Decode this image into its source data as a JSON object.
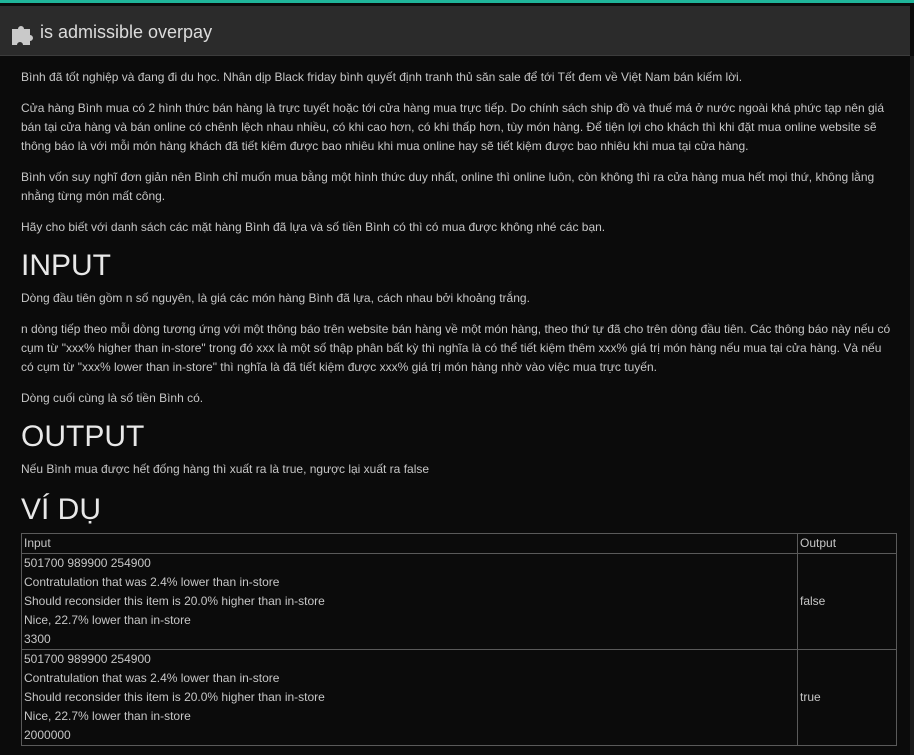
{
  "window": {
    "title": "is admissible overpay",
    "icon": "puzzle-piece-icon"
  },
  "problem": {
    "paragraphs": [
      "Bình đã tốt nghiệp và đang đi du học. Nhân dịp Black friday bình quyết định tranh thủ săn sale để tới Tết đem về Việt Nam bán kiếm lời.",
      "Cửa hàng Bình mua có 2 hình thức bán hàng là trực tuyết hoặc tới cửa hàng mua trực tiếp. Do chính sách ship đồ và thuế má ở nước ngoài khá phức tạp nên giá bán tại cửa hàng và bán online có chênh lệch nhau nhiều, có khi cao hơn, có khi thấp hơn, tùy món hàng.  Để tiện lợi cho khách thì khi đặt mua online website sẽ thông báo là với mỗi món hàng khách đã tiết kiêm được bao nhiêu khi mua online hay sẽ tiết kiệm được bao nhiêu khi mua tại cửa hàng.",
      "Bình vốn suy nghĩ đơn giản nên Bình chỉ muốn mua bằng một hình thức duy nhất, online thì online luôn, còn không thì ra cửa hàng mua hết mọi thứ, không lằng nhằng từng món mất công.",
      "Hãy cho biết với danh sách các mặt hàng Bình đã lựa và số tiền Bình có thì có mua được không nhé các bạn."
    ],
    "input_heading": "INPUT",
    "input_paragraphs": [
      "Dòng đầu tiên gồm n số nguyên, là giá các món hàng Bình đã lựa, cách nhau bởi khoảng trắng.",
      "n  dòng tiếp theo mỗi dòng tương ứng với một thông báo trên website bán hàng về một món hàng, theo thứ tự đã cho trên dòng đầu tiên. Các thông báo này nếu có cụm từ \"xxx% higher than in-store\" trong đó xxx là một số thập phân bất kỳ thì nghĩa là có thể tiết kiệm thêm xxx% giá trị món hàng nếu mua tại cửa hàng. Và nếu có cụm từ \"xxx% lower than in-store\" thì nghĩa là đã tiết kiệm được xxx% giá trị món hàng nhờ vào việc mua trực tuyến.",
      "Dòng cuối cùng là số tiền Bình có."
    ],
    "output_heading": "OUTPUT",
    "output_paragraph": "Nếu Bình mua được hết đống hàng thì xuất ra là true, ngược lại xuất ra false",
    "example_heading": "VÍ DỤ",
    "examples": {
      "headers": {
        "input": "Input",
        "output": "Output"
      },
      "rows": [
        {
          "input_lines": [
            "501700 989900 254900",
            "Contratulation that was 2.4% lower than in-store",
            "Should reconsider this item is 20.0% higher than in-store",
            "Nice, 22.7% lower than in-store",
            "3300"
          ],
          "output": "false"
        },
        {
          "input_lines": [
            "501700 989900 254900",
            "Contratulation that was 2.4% lower than in-store",
            "Should reconsider this item is 20.0% higher than in-store",
            "Nice, 22.7% lower than in-store",
            "2000000"
          ],
          "output": "true"
        }
      ]
    }
  },
  "colors": {
    "accent": "#1fb59a",
    "titlebar": "#2b2b2b",
    "background": "#0b0b0b",
    "text": "#c6c6c6"
  }
}
